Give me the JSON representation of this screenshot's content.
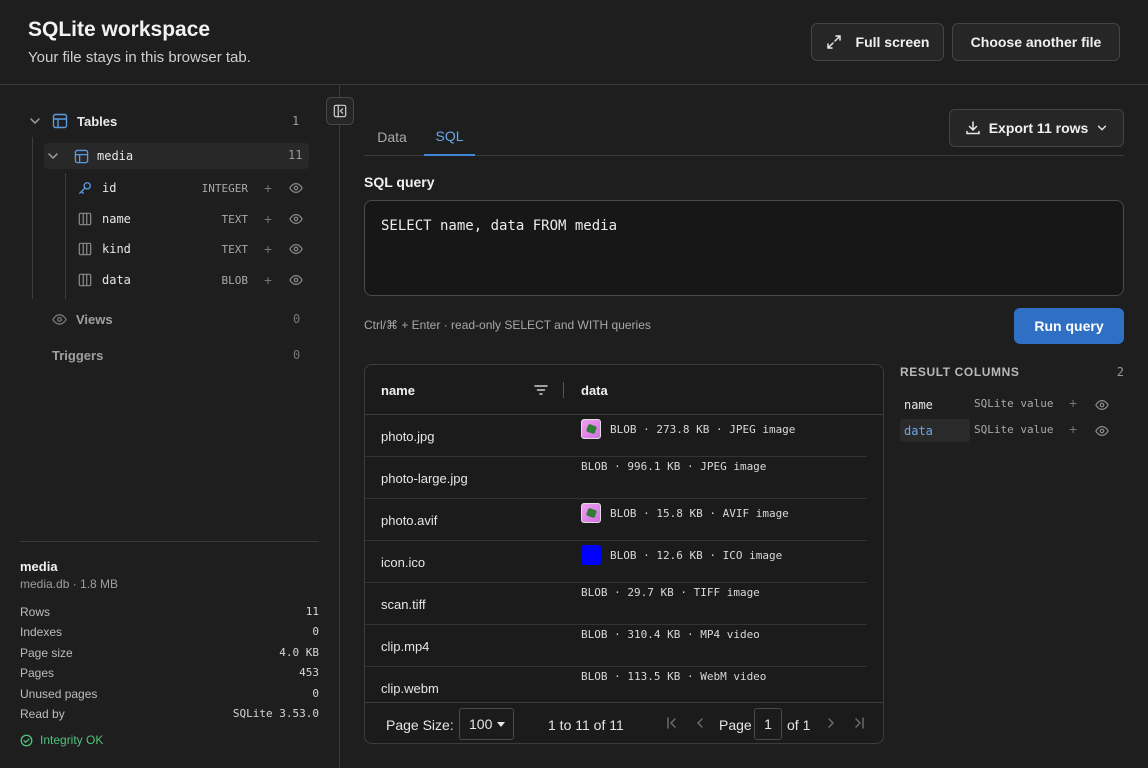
{
  "header": {
    "title": "SQLite workspace",
    "subtitle": "Your file stays in this browser tab.",
    "fullscreen_label": "Full screen",
    "choose_label": "Choose another file"
  },
  "sidebar": {
    "tables_label": "Tables",
    "tables_count": "1",
    "table": {
      "name": "media",
      "count": "11"
    },
    "columns": [
      {
        "name": "id",
        "type": "INTEGER",
        "icon": "key-icon"
      },
      {
        "name": "name",
        "type": "TEXT",
        "icon": "column-icon"
      },
      {
        "name": "kind",
        "type": "TEXT",
        "icon": "column-icon"
      },
      {
        "name": "data",
        "type": "BLOB",
        "icon": "column-icon"
      }
    ],
    "views_label": "Views",
    "views_count": "0",
    "triggers_label": "Triggers",
    "triggers_count": "0"
  },
  "info": {
    "name": "media",
    "subtitle": "media.db · 1.8 MB",
    "rows": [
      {
        "label": "Rows",
        "value": "11"
      },
      {
        "label": "Indexes",
        "value": "0"
      },
      {
        "label": "Page size",
        "value": "4.0 KB"
      },
      {
        "label": "Pages",
        "value": "453"
      },
      {
        "label": "Unused pages",
        "value": "0"
      },
      {
        "label": "Read by",
        "value": "SQLite 3.53.0"
      }
    ],
    "integrity": "Integrity OK"
  },
  "main": {
    "tabs": [
      {
        "label": "Data"
      },
      {
        "label": "SQL"
      }
    ],
    "active_tab": "SQL",
    "export_label": "Export 11 rows",
    "sql_label": "SQL query",
    "sql_text": "SELECT name, data FROM media",
    "hint": "Ctrl/⌘ + Enter · read-only SELECT and WITH queries",
    "run_label": "Run query"
  },
  "grid": {
    "headers": [
      "name",
      "data"
    ],
    "rows": [
      {
        "name": "photo.jpg",
        "data": "BLOB · 273.8 KB · JPEG image",
        "thumb": "photo"
      },
      {
        "name": "photo-large.jpg",
        "data": "BLOB · 996.1 KB · JPEG image",
        "thumb": ""
      },
      {
        "name": "photo.avif",
        "data": "BLOB · 15.8 KB · AVIF image",
        "thumb": "photo"
      },
      {
        "name": "icon.ico",
        "data": "BLOB · 12.6 KB · ICO image",
        "thumb": "icon"
      },
      {
        "name": "scan.tiff",
        "data": "BLOB · 29.7 KB · TIFF image",
        "thumb": ""
      },
      {
        "name": "clip.mp4",
        "data": "BLOB · 310.4 KB · MP4 video",
        "thumb": ""
      },
      {
        "name": "clip.webm",
        "data": "BLOB · 113.5 KB · WebM video",
        "thumb": ""
      }
    ],
    "footer": {
      "page_size_label": "Page Size:",
      "page_size_value": "100",
      "range": "1 to 11 of 11",
      "page_label": "Page",
      "page_value": "1",
      "of_label": "of 1"
    }
  },
  "result_columns": {
    "title": "RESULT COLUMNS",
    "count": "2",
    "items": [
      {
        "name": "name",
        "type": "SQLite value"
      },
      {
        "name": "data",
        "type": "SQLite value"
      }
    ]
  },
  "colors": {
    "accent": "#2f6fc4",
    "tab_active": "#6aa7e8",
    "success": "#4fc27a",
    "icon_blue": "#5a9be0"
  }
}
